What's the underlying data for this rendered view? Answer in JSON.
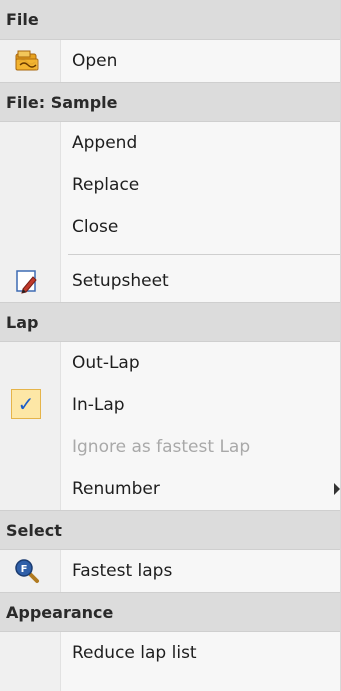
{
  "menu": {
    "sections": {
      "file": {
        "header": "File",
        "open": {
          "label": "Open",
          "icon": "open-folder-icon"
        }
      },
      "file_sample": {
        "header": "File: Sample",
        "append": {
          "label": "Append"
        },
        "replace": {
          "label": "Replace"
        },
        "close": {
          "label": "Close"
        },
        "setupsheet": {
          "label": "Setupsheet",
          "icon": "setupsheet-icon"
        }
      },
      "lap": {
        "header": "Lap",
        "out_lap": {
          "label": "Out-Lap"
        },
        "in_lap": {
          "label": "In-Lap",
          "checked": true,
          "check_glyph": "✓"
        },
        "ignore": {
          "label": "Ignore as fastest Lap",
          "disabled": true
        },
        "renumber": {
          "label": "Renumber",
          "has_submenu": true
        }
      },
      "select": {
        "header": "Select",
        "fastest": {
          "label": "Fastest laps",
          "icon": "fastest-search-icon"
        }
      },
      "appearance": {
        "header": "Appearance",
        "reduce": {
          "label": "Reduce lap list"
        }
      }
    },
    "colors": {
      "header_bg": "#dcdcdc",
      "check_bg": "#fde7a6",
      "check_border": "#e5b44a",
      "disabled_text": "#a9a9a9"
    }
  }
}
